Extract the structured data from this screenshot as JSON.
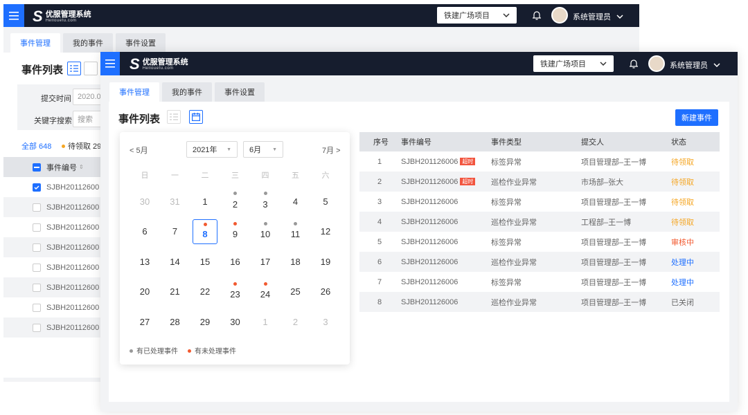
{
  "app": {
    "name": "优服管理系统",
    "sub": "Hellouefu.com"
  },
  "header": {
    "project": "铁建广场项目",
    "user": "系统管理员"
  },
  "tabs": [
    "事件管理",
    "我的事件",
    "事件设置"
  ],
  "page_title": "事件列表",
  "new_button": "新建事件",
  "back": {
    "filter_time_label": "提交时间",
    "filter_time_value": "2020.0",
    "filter_kw_label": "关键字搜索",
    "filter_kw_placeholder": "搜索",
    "count_all": "全部 648",
    "count_pending": "待领取 29",
    "col_id": "事件编号",
    "rows": [
      "SJBH20112600",
      "SJBH20112600",
      "SJBH20112600",
      "SJBH20112600",
      "SJBH20112600",
      "SJBH20112600",
      "SJBH20112600",
      "SJBH20112600"
    ]
  },
  "calendar": {
    "prev": "< 5月",
    "next": "7月 >",
    "year": "2021年",
    "month": "6月",
    "weekdays": [
      "日",
      "一",
      "二",
      "三",
      "四",
      "五",
      "六"
    ],
    "weeks": [
      [
        "30",
        "31",
        "1",
        "2",
        "3",
        "4",
        "5"
      ],
      [
        "6",
        "7",
        "8",
        "9",
        "10",
        "11",
        "12"
      ],
      [
        "13",
        "14",
        "15",
        "16",
        "17",
        "18",
        "19"
      ],
      [
        "20",
        "21",
        "22",
        "23",
        "24",
        "25",
        "26"
      ],
      [
        "27",
        "28",
        "29",
        "30",
        "1",
        "2",
        "3"
      ]
    ],
    "legend_done": "有已处理事件",
    "legend_pending": "有未处理事件"
  },
  "table": {
    "headers": [
      "序号",
      "事件编号",
      "事件类型",
      "提交人",
      "状态"
    ],
    "overdue": "超时",
    "rows": [
      {
        "no": "1",
        "id": "SJBH201126006",
        "overdue": true,
        "type": "标签异常",
        "by": "项目管理部–王一博",
        "status": "待领取"
      },
      {
        "no": "2",
        "id": "SJBH201126006",
        "overdue": true,
        "type": "巡检作业异常",
        "by": "市场部–张大",
        "status": "待领取"
      },
      {
        "no": "3",
        "id": "SJBH201126006",
        "overdue": false,
        "type": "标签异常",
        "by": "项目管理部–王一博",
        "status": "待领取"
      },
      {
        "no": "4",
        "id": "SJBH201126006",
        "overdue": false,
        "type": "巡检作业异常",
        "by": "工程部–王一博",
        "status": "待领取"
      },
      {
        "no": "5",
        "id": "SJBH201126006",
        "overdue": false,
        "type": "标签异常",
        "by": "项目管理部–王一博",
        "status": "审核中"
      },
      {
        "no": "6",
        "id": "SJBH201126006",
        "overdue": false,
        "type": "巡检作业异常",
        "by": "项目管理部–王一博",
        "status": "处理中"
      },
      {
        "no": "7",
        "id": "SJBH201126006",
        "overdue": false,
        "type": "标签异常",
        "by": "项目管理部–王一博",
        "status": "处理中"
      },
      {
        "no": "8",
        "id": "SJBH201126006",
        "overdue": false,
        "type": "巡检作业异常",
        "by": "项目管理部–王一博",
        "status": "已关闭"
      }
    ]
  },
  "colors": {
    "primary": "#1e6fff",
    "dark": "#161d2e",
    "pending": "#f5a623",
    "reviewing": "#f25a30",
    "processing": "#1e6fff",
    "closed": "#666666",
    "dot_done": "#999999",
    "dot_pending": "#f25a30"
  }
}
